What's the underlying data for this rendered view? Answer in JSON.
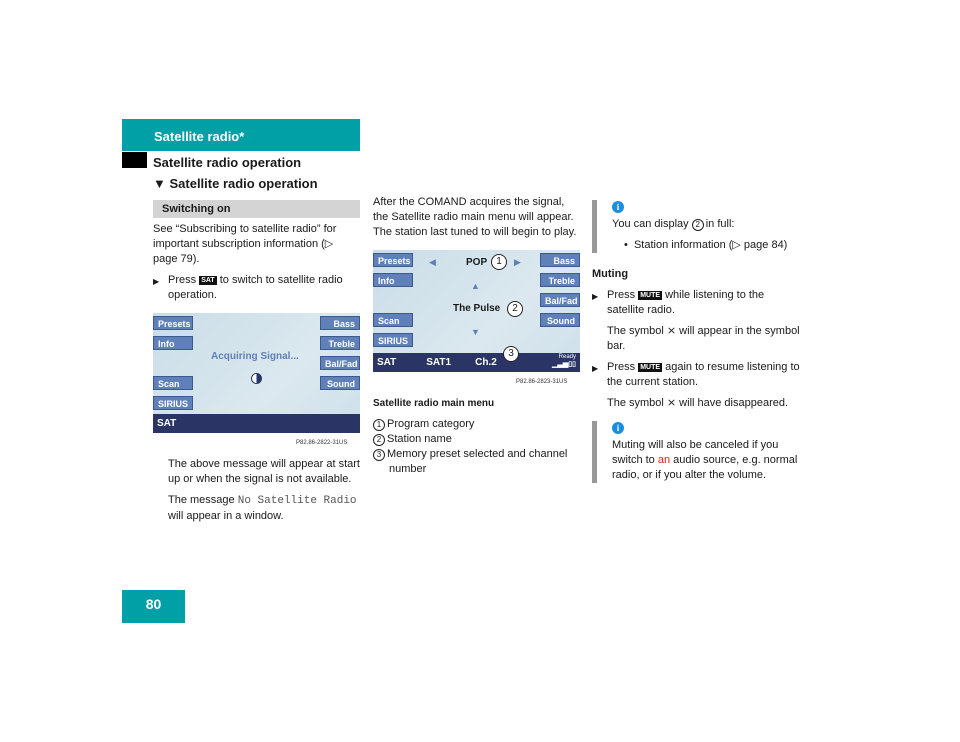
{
  "header": {
    "section": "Satellite radio*",
    "title": "Satellite radio operation",
    "subtitle": "Satellite radio operation",
    "page_number": "80"
  },
  "col1": {
    "heading": "Switching on",
    "intro": "See “Subscribing to satellite radio” for important subscription information (▷ page 79).",
    "step_pre": "Press",
    "step_key": "SAT",
    "step_post": "to switch to satellite radio operation.",
    "screen": {
      "left": [
        "Presets",
        "Info",
        "Scan",
        "SIRIUS"
      ],
      "right": [
        "Bass",
        "Treble",
        "Bal/Fad",
        "Sound"
      ],
      "message": "Acquiring Signal...",
      "bar": "SAT",
      "code": "P82.86-2822-31US"
    },
    "p1": "The above message will appear at start up or when the signal is not available.",
    "p2_pre": "The message",
    "p2_mono": "No Satellite Radio",
    "p2_post": "will appear in a window."
  },
  "col2": {
    "intro": "After the COMAND acquires the signal, the Satellite radio main menu will appear. The station last tuned to will begin to play.",
    "screen": {
      "left": [
        "Presets",
        "Info",
        "Scan",
        "SIRIUS"
      ],
      "right": [
        "Bass",
        "Treble",
        "Bal/Fad",
        "Sound"
      ],
      "category": "POP",
      "station": "The Pulse",
      "bar": [
        "SAT",
        "SAT1",
        "Ch.2"
      ],
      "ready": "Ready",
      "callouts": [
        "1",
        "2",
        "3"
      ],
      "code": "P82.86-2823-31US"
    },
    "caption": "Satellite radio main menu",
    "legend": [
      {
        "n": "1",
        "t": "Program category"
      },
      {
        "n": "2",
        "t": "Station name"
      },
      {
        "n": "3",
        "t": "Memory preset selected and channel number"
      }
    ]
  },
  "col3": {
    "info1_pre": "You can display",
    "info1_ref": "2",
    "info1_post": "in full:",
    "info1_bullet": "Station information (▷ page 84)",
    "heading": "Muting",
    "s1_pre": "Press",
    "key": "MUTE",
    "s1_post": "while listening to the satellite radio.",
    "s1_res": "The symbol ⨯ will appear in the symbol bar.",
    "s2_post": "again to resume listening to the current station.",
    "s2_res": "The symbol ⨯ will have disappeared.",
    "info2_a": "Muting will also be canceled if you switch to",
    "info2_red": "an",
    "info2_b": "audio source, e.g. normal radio, or if you alter the volume."
  },
  "colors": {
    "accent": "#00a0a6",
    "button": "#5f80b9",
    "bar": "#2a3566"
  }
}
